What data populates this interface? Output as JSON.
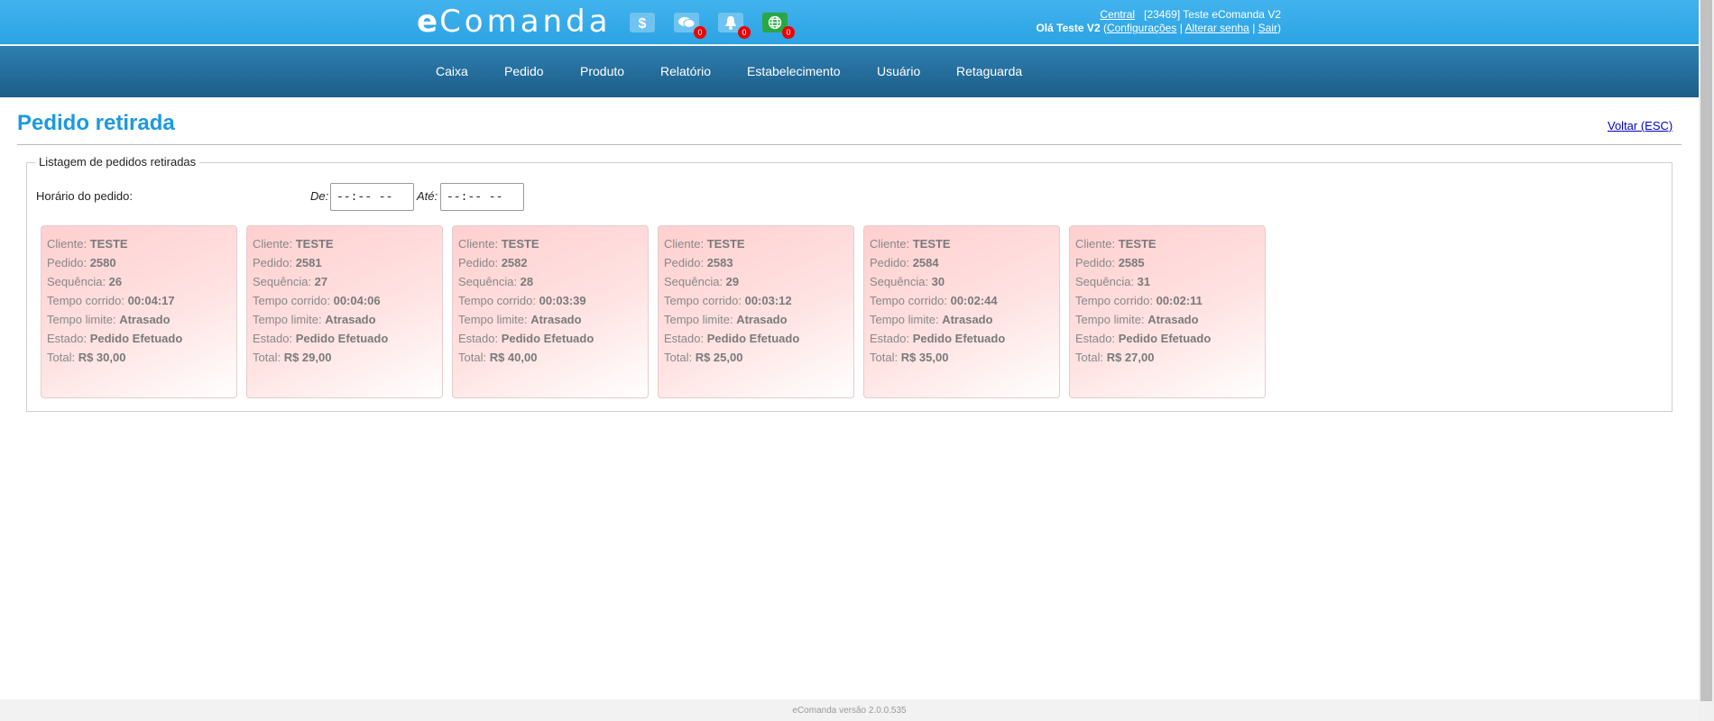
{
  "header": {
    "logo_e": "e",
    "logo_rest": "Comanda",
    "icons": [
      {
        "name": "dollar-icon",
        "badge": ""
      },
      {
        "name": "chat-icon",
        "badge": "0"
      },
      {
        "name": "bell-icon",
        "badge": "0"
      },
      {
        "name": "globe-icon",
        "badge": "0"
      }
    ],
    "central_link": "Central",
    "account_info": "[23469] Teste eComanda V2",
    "greeting": "Olá Teste V2",
    "config_link": "Configurações",
    "change_password_link": "Alterar senha",
    "logout_link": "Sair"
  },
  "nav": {
    "items": [
      "Caixa",
      "Pedido",
      "Produto",
      "Relatório",
      "Estabelecimento",
      "Usuário",
      "Retaguarda"
    ]
  },
  "page": {
    "title": "Pedido retirada",
    "back_link": "Voltar (ESC)",
    "legend": "Listagem de pedidos retiradas",
    "filter_label": "Horário do pedido:",
    "from_label": "De:",
    "to_label": "Até:",
    "from_value": "--:-- --",
    "to_value": "--:-- --"
  },
  "card_labels": {
    "client": "Cliente: ",
    "order": "Pedido: ",
    "sequence": "Sequência: ",
    "elapsed": "Tempo corrido: ",
    "limit": "Tempo limite: ",
    "state": "Estado: ",
    "total": "Total: "
  },
  "orders": [
    {
      "client": "TESTE",
      "order": "2580",
      "sequence": "26",
      "elapsed": "00:04:17",
      "limit": "Atrasado",
      "state": "Pedido Efetuado",
      "total": "R$ 30,00"
    },
    {
      "client": "TESTE",
      "order": "2581",
      "sequence": "27",
      "elapsed": "00:04:06",
      "limit": "Atrasado",
      "state": "Pedido Efetuado",
      "total": "R$ 29,00"
    },
    {
      "client": "TESTE",
      "order": "2582",
      "sequence": "28",
      "elapsed": "00:03:39",
      "limit": "Atrasado",
      "state": "Pedido Efetuado",
      "total": "R$ 40,00"
    },
    {
      "client": "TESTE",
      "order": "2583",
      "sequence": "29",
      "elapsed": "00:03:12",
      "limit": "Atrasado",
      "state": "Pedido Efetuado",
      "total": "R$ 25,00"
    },
    {
      "client": "TESTE",
      "order": "2584",
      "sequence": "30",
      "elapsed": "00:02:44",
      "limit": "Atrasado",
      "state": "Pedido Efetuado",
      "total": "R$ 35,00"
    },
    {
      "client": "TESTE",
      "order": "2585",
      "sequence": "31",
      "elapsed": "00:02:11",
      "limit": "Atrasado",
      "state": "Pedido Efetuado",
      "total": "R$ 27,00"
    }
  ],
  "footer": {
    "version": "eComanda versão 2.0.0.535"
  },
  "colors": {
    "header": "#2ca3e3",
    "nav": "#1c5d88",
    "title": "#1a9ae0",
    "badge": "#ee0000",
    "card": "#ffcfcf"
  }
}
